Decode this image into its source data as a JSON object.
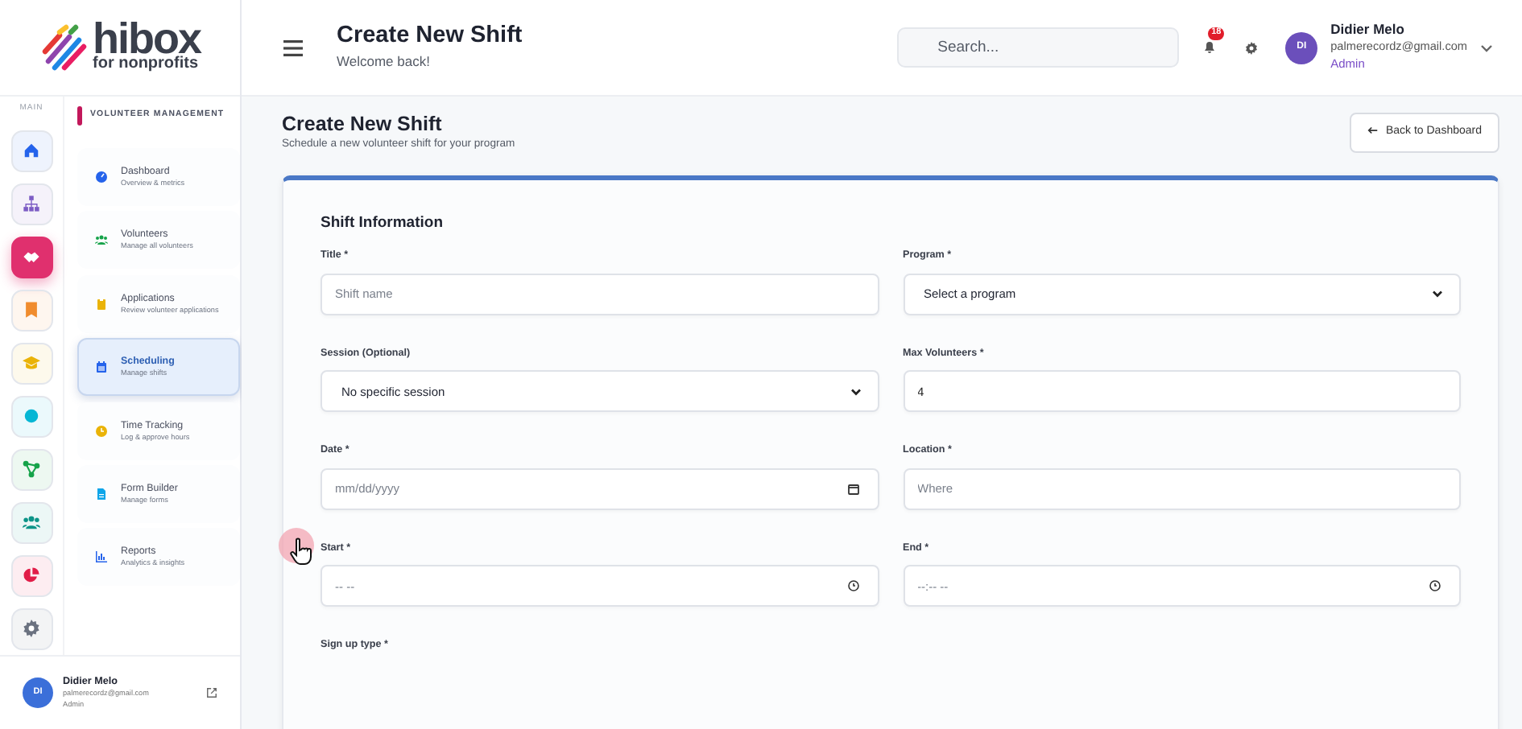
{
  "brand": {
    "name": "hibox",
    "tagline": "for nonprofits"
  },
  "rail": {
    "label": "MAIN",
    "items": [
      {
        "color": "#2563eb",
        "selected": false
      },
      {
        "color": "#7c5cc4",
        "selected": false
      },
      {
        "color": "#e0306e",
        "selected": true
      },
      {
        "color": "#f08c2e",
        "selected": false
      },
      {
        "color": "#eab308",
        "selected": false
      },
      {
        "color": "#06b6d4",
        "selected": false
      },
      {
        "color": "#16a34a",
        "selected": false
      },
      {
        "color": "#0d9488",
        "selected": false
      },
      {
        "color": "#e11d48",
        "selected": false
      },
      {
        "color": "#6b7280",
        "selected": false
      }
    ]
  },
  "nav": {
    "heading": "VOLUNTEER MANAGEMENT",
    "items": [
      {
        "color": "#2563eb",
        "title": "Dashboard",
        "subtitle": "Overview & metrics",
        "selected": false
      },
      {
        "color": "#16a34a",
        "title": "Volunteers",
        "subtitle": "Manage all volunteers",
        "selected": false
      },
      {
        "color": "#eab308",
        "title": "Applications",
        "subtitle": "Review volunteer applications",
        "selected": false
      },
      {
        "color": "#2563eb",
        "title": "Scheduling",
        "subtitle": "Manage shifts",
        "selected": true
      },
      {
        "color": "#eab308",
        "title": "Time Tracking",
        "subtitle": "Log & approve hours",
        "selected": false
      },
      {
        "color": "#0ea5e9",
        "title": "Form Builder",
        "subtitle": "Manage forms",
        "selected": false
      },
      {
        "color": "#2563eb",
        "title": "Reports",
        "subtitle": "Analytics & insights",
        "selected": false
      }
    ]
  },
  "sidebar_user": {
    "initials": "DI",
    "name": "Didier Melo",
    "email": "palmerecordz@gmail.com",
    "role": "Admin"
  },
  "header": {
    "title": "Create New Shift",
    "subtitle": "Welcome back!",
    "search_placeholder": "Search...",
    "notification_count": "18",
    "user": {
      "initials": "DI",
      "name": "Didier Melo",
      "email": "palmerecordz@gmail.com",
      "role": "Admin"
    }
  },
  "page": {
    "title": "Create New Shift",
    "subtitle": "Schedule a new volunteer shift for your program",
    "back_button": "Back to Dashboard"
  },
  "form": {
    "section": "Shift Information",
    "fields": [
      {
        "label": "Title *",
        "kind": "text",
        "placeholder": "Shift name"
      },
      {
        "label": "Program *",
        "kind": "select",
        "value": "Select a program"
      },
      {
        "label": "Session (Optional)",
        "kind": "select",
        "value": "No specific session"
      },
      {
        "label": "Max Volunteers *",
        "kind": "text",
        "value": "4"
      },
      {
        "label": "Date *",
        "kind": "date",
        "placeholder": "mm/dd/yyyy"
      },
      {
        "label": "Location *",
        "kind": "text",
        "placeholder": "Where"
      },
      {
        "label": "Start *",
        "kind": "time",
        "placeholder": "-- --"
      },
      {
        "label": "End *",
        "kind": "time",
        "placeholder": "--:-- --"
      },
      {
        "label": "Sign up type *",
        "kind": "none"
      }
    ]
  }
}
